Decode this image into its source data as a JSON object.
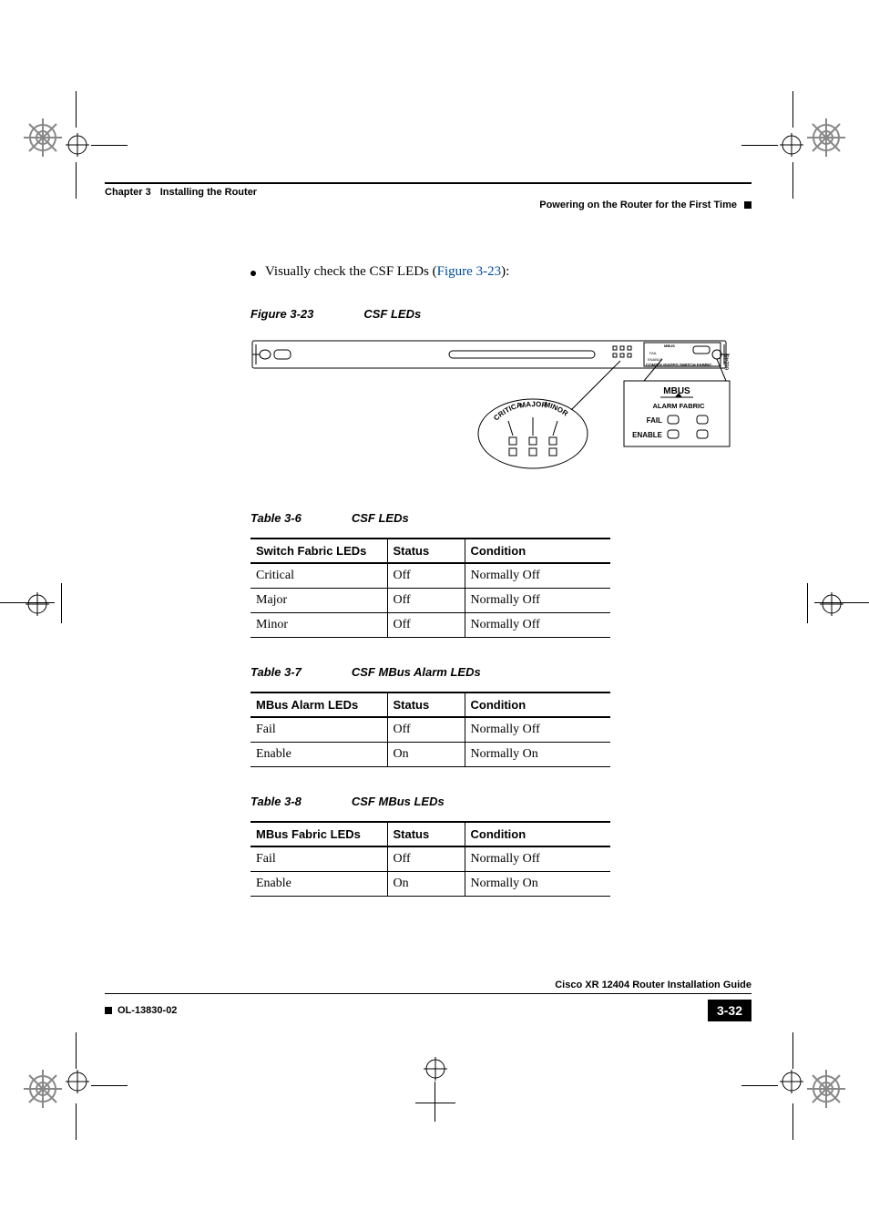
{
  "header": {
    "chapter_label": "Chapter 3",
    "chapter_title": "Installing the Router",
    "section_title": "Powering on the Router for the First Time"
  },
  "body": {
    "bullet_text_pre": "Visually check the CSF LEDs (",
    "bullet_xref": "Figure 3-23",
    "bullet_text_post": "):",
    "figure_caption_num": "Figure 3-23",
    "figure_caption_title": "CSF LEDs"
  },
  "figure": {
    "callouts": {
      "critical": "CRITICAL",
      "major": "MAJOR",
      "minor": "MINOR"
    },
    "panel": {
      "title": "MBUS",
      "row_label": "ALARM  FABRIC",
      "fail": "FAIL",
      "enable": "ENABLE",
      "strip_label": "CONSOLIDATED SWITCH FABRIC",
      "side_number": "66246",
      "mini_mbus": "MBUS",
      "mini_fail": "FAIL",
      "mini_enable": "ENABLE"
    }
  },
  "tables": {
    "t1": {
      "caption_num": "Table 3-6",
      "caption_title": "CSF LEDs",
      "headers": [
        "Switch Fabric LEDs",
        "Status",
        "Condition"
      ],
      "rows": [
        [
          "Critical",
          "Off",
          "Normally Off"
        ],
        [
          "Major",
          "Off",
          "Normally Off"
        ],
        [
          "Minor",
          "Off",
          "Normally Off"
        ]
      ]
    },
    "t2": {
      "caption_num": "Table 3-7",
      "caption_title": "CSF MBus Alarm LEDs",
      "headers": [
        "MBus Alarm LEDs",
        "Status",
        "Condition"
      ],
      "rows": [
        [
          "Fail",
          "Off",
          "Normally Off"
        ],
        [
          "Enable",
          "On",
          "Normally On"
        ]
      ]
    },
    "t3": {
      "caption_num": "Table 3-8",
      "caption_title": "CSF MBus LEDs",
      "headers": [
        "MBus Fabric LEDs",
        "Status",
        "Condition"
      ],
      "rows": [
        [
          "Fail",
          "Off",
          "Normally Off"
        ],
        [
          "Enable",
          "On",
          "Normally On"
        ]
      ]
    }
  },
  "footer": {
    "book_title": "Cisco XR 12404 Router Installation Guide",
    "doc_id": "OL-13830-02",
    "page_num": "3-32"
  }
}
